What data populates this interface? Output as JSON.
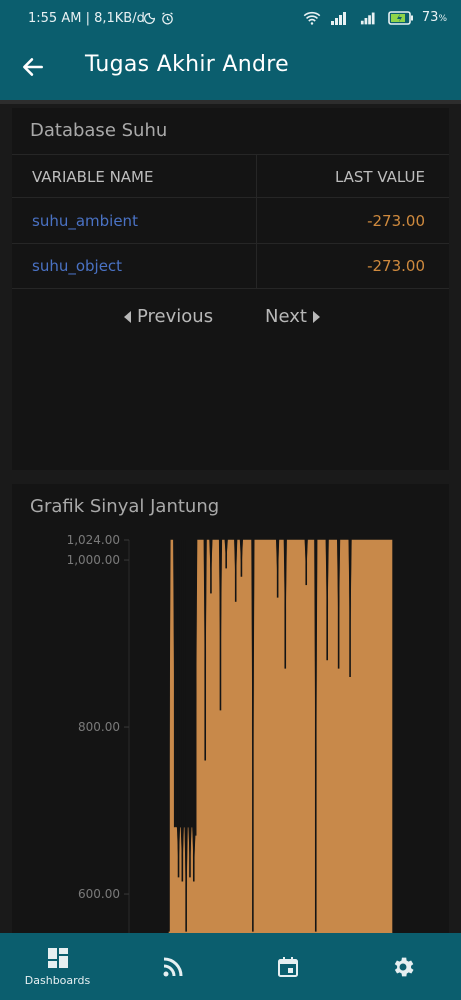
{
  "status_bar": {
    "left_text": "1:55 AM | 8,1KB/d",
    "battery_text": "73",
    "icons": [
      "moon-icon",
      "alarm-icon",
      "wifi-icon",
      "signal-icon",
      "battery-icon"
    ]
  },
  "app_bar": {
    "title": "Tugas Akhir Andre",
    "back_icon": "arrow-left-icon"
  },
  "table_card": {
    "title": "Database Suhu",
    "columns": [
      "VARIABLE NAME",
      "LAST VALUE"
    ],
    "rows": [
      {
        "name": "suhu_ambient",
        "value": "-273.00"
      },
      {
        "name": "suhu_object",
        "value": "-273.00"
      }
    ],
    "prev_label": "Previous",
    "next_label": "Next",
    "colors": {
      "name": "#4a72c4",
      "value": "#cf8a3e"
    }
  },
  "chart_card": {
    "title": "Grafik Sinyal Jantung"
  },
  "chart_data": {
    "type": "area",
    "title": "Grafik Sinyal Jantung",
    "y_ticks": [
      "1,024.00",
      "1,000.00",
      "800.00",
      "600.00"
    ],
    "y_tick_values": [
      1024,
      1000,
      800,
      600
    ],
    "ylim": [
      555,
      1024
    ],
    "color": "#c8894a",
    "grid": false,
    "series": [
      {
        "values": [
          555,
          1024,
          1024,
          680,
          680,
          620,
          680,
          615,
          680,
          555,
          680,
          620,
          680,
          615,
          670,
          1024,
          1024,
          1024,
          1024,
          760,
          1024,
          1024,
          960,
          1024,
          1024,
          1024,
          1024,
          820,
          1024,
          1024,
          990,
          1024,
          1024,
          1024,
          1024,
          950,
          1024,
          1024,
          980,
          1024,
          1024,
          1024,
          1024,
          1024,
          555,
          1024,
          1024,
          1024,
          1024,
          1024,
          1024,
          1024,
          1024,
          1024,
          1024,
          1024,
          1024,
          955,
          1024,
          1024,
          1024,
          870,
          1024,
          1024,
          1024,
          1024,
          1024,
          1024,
          1024,
          1024,
          1024,
          1024,
          970,
          1024,
          1024,
          1024,
          1024,
          555,
          1024,
          1024,
          1024,
          1024,
          1024,
          880,
          1024,
          1024,
          1024,
          1024,
          1024,
          870,
          1024,
          1024,
          1024,
          1024,
          1024,
          860,
          1024,
          1024,
          1024,
          1024,
          1024,
          1024,
          1024,
          1024,
          1024,
          1024,
          1024,
          1024,
          1024,
          1024,
          1024,
          1024,
          1024,
          1024,
          1024,
          1024,
          1024,
          1024
        ]
      }
    ]
  },
  "bottom_nav": {
    "items": [
      {
        "label": "Dashboards",
        "icon": "dashboard-icon",
        "active": true
      },
      {
        "label": "",
        "icon": "rss-feed-icon",
        "active": false
      },
      {
        "label": "",
        "icon": "calendar-icon",
        "active": false
      },
      {
        "label": "",
        "icon": "settings-gear-icon",
        "active": false
      }
    ]
  }
}
